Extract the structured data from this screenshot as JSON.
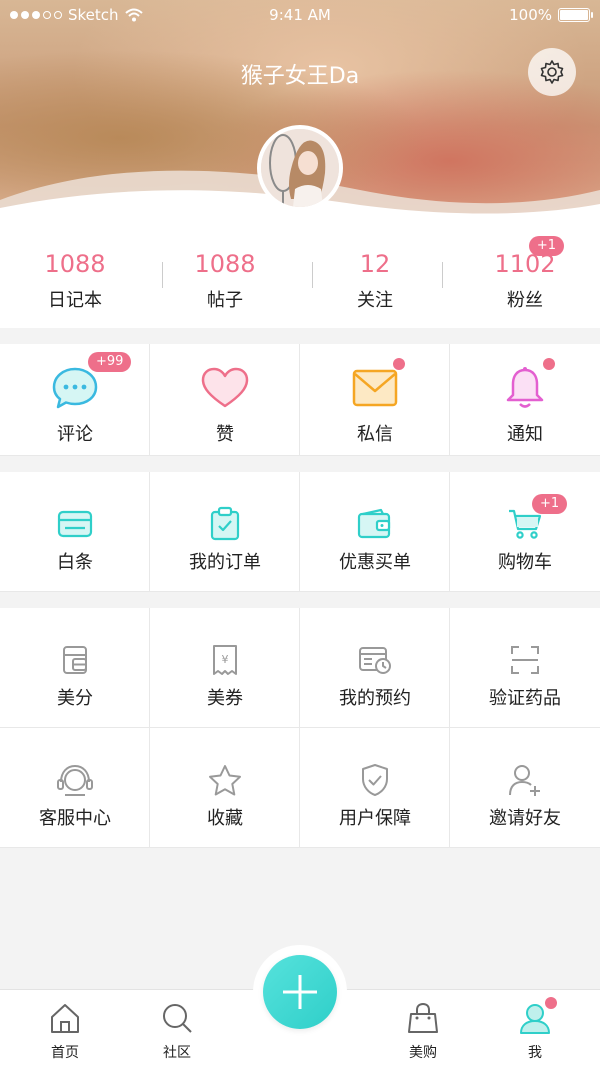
{
  "status_bar": {
    "carrier": "Sketch",
    "time": "9:41 AM",
    "battery": "100%"
  },
  "profile": {
    "username": "猴子女王Da"
  },
  "stats": [
    {
      "value": "1088",
      "label": "日记本"
    },
    {
      "value": "1088",
      "label": "帖子"
    },
    {
      "value": "12",
      "label": "关注"
    },
    {
      "value": "1102",
      "label": "粉丝",
      "badge": "+1"
    }
  ],
  "messages": [
    {
      "label": "评论",
      "icon": "comment-icon",
      "badge": "+99"
    },
    {
      "label": "赞",
      "icon": "heart-icon"
    },
    {
      "label": "私信",
      "icon": "envelope-icon"
    },
    {
      "label": "通知",
      "icon": "bell-icon"
    }
  ],
  "shopping": [
    {
      "label": "白条",
      "icon": "card-icon"
    },
    {
      "label": "我的订单",
      "icon": "order-clipboard-icon"
    },
    {
      "label": "优惠买单",
      "icon": "wallet-icon"
    },
    {
      "label": "购物车",
      "icon": "cart-icon",
      "badge": "+1"
    }
  ],
  "services": [
    {
      "label": "美分",
      "icon": "points-icon"
    },
    {
      "label": "美券",
      "icon": "coupon-icon"
    },
    {
      "label": "我的预约",
      "icon": "appointment-icon"
    },
    {
      "label": "验证药品",
      "icon": "scan-icon"
    },
    {
      "label": "客服中心",
      "icon": "headset-icon"
    },
    {
      "label": "收藏",
      "icon": "star-icon"
    },
    {
      "label": "用户保障",
      "icon": "shield-icon"
    },
    {
      "label": "邀请好友",
      "icon": "invite-user-icon"
    }
  ],
  "tabbar": [
    {
      "label": "首页",
      "icon": "home-icon"
    },
    {
      "label": "社区",
      "icon": "search-icon"
    },
    {
      "label": "美购",
      "icon": "bag-icon"
    },
    {
      "label": "我",
      "icon": "me-icon"
    }
  ],
  "colors": {
    "accent_pink": "#ee6f8a",
    "accent_teal": "#2fcfc9"
  }
}
